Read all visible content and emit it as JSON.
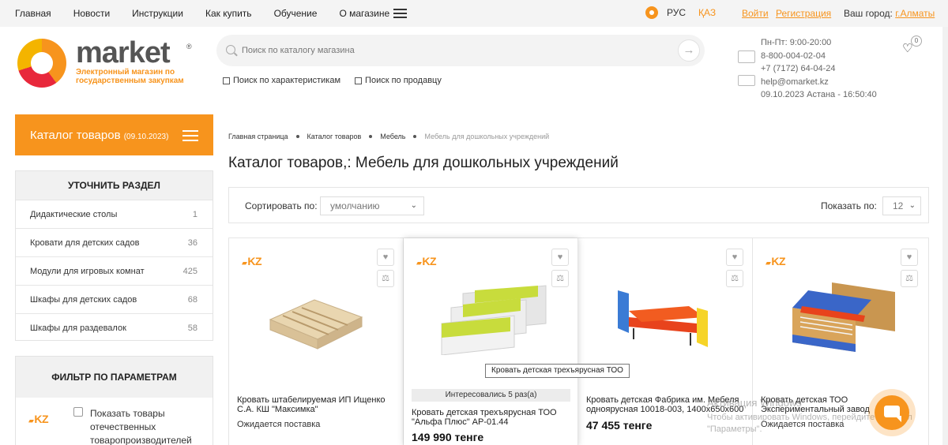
{
  "topnav": {
    "links": [
      "Главная",
      "Новости",
      "Инструкции",
      "Как купить",
      "Обучение",
      "О магазине"
    ],
    "lang_ru": "РУС",
    "lang_kz": "ҚАЗ",
    "login": "Войти",
    "register": "Регистрация",
    "city_label": "Ваш город:",
    "city": "г.Алматы"
  },
  "logo": {
    "word": "market",
    "reg": "®",
    "tagline": "Электронный магазин по государственным закупкам"
  },
  "search": {
    "placeholder": "Поиск по каталогу магазина",
    "go": "→",
    "opt1": "Поиск по характеристикам",
    "opt2": "Поиск по продавцу"
  },
  "contacts": {
    "hours": "Пн-Пт: 9:00-20:00",
    "phone1": "8-800-004-02-04",
    "phone2": "+7 (7172) 64-04-24",
    "email": "help@omarket.kz",
    "datetime": "09.10.2023   Астана - 16:50:40",
    "fav_count": "0"
  },
  "catalog": {
    "title": "Каталог товаров",
    "date": "(09.10.2023)"
  },
  "sections": {
    "title": "УТОЧНИТЬ РАЗДЕЛ",
    "items": [
      {
        "name": "Дидактические столы",
        "count": "1"
      },
      {
        "name": "Кровати для детских садов",
        "count": "36"
      },
      {
        "name": "Модули для игровых комнат",
        "count": "425"
      },
      {
        "name": "Шкафы для детских садов",
        "count": "68"
      },
      {
        "name": "Шкафы для раздевалок",
        "count": "58"
      }
    ]
  },
  "filter": {
    "title": "ФИЛЬТР ПО ПАРАМЕТРАМ",
    "kz_badge": "KZ",
    "domestic_label": "Показать товары отечественных товаропроизводителей"
  },
  "breadcrumb": [
    "Главная страница",
    "Каталог товаров",
    "Мебель",
    "Мебель для дошкольных учреждений"
  ],
  "page_title": "Каталог товаров,: Мебель для дошкольных учреждений",
  "sort": {
    "label": "Сортировать по:",
    "value": "умолчанию",
    "show_label": "Показать по:",
    "show_value": "12"
  },
  "products": [
    {
      "kz": "KZ",
      "name": "Кровать штабелируемая ИП Ищенко С.А. КШ \"Максимка\"",
      "status": "Ожидается поставка"
    },
    {
      "kz": "KZ",
      "interest": "Интересовались 5 раз(а)",
      "name": "Кровать детская трехъярусная ТОО \"Альфа Плюс\" АР-01.44",
      "price": "149 990 тенге",
      "tooltip": "Кровать детская трехъярусная ТОО"
    },
    {
      "name": "Кровать детская Фабрика им. Мебеля одноярусная 10018-003, 1400х650х600",
      "price": "47 455 тенге"
    },
    {
      "kz": "KZ",
      "name": "Кровать детская ТОО Экспериментальный завод",
      "status": "Ожидается поставка"
    }
  ],
  "activation": {
    "line1": "Активация Windows",
    "line2": "Чтобы активировать Windows, перейдите в раздел",
    "line3": "\"Параметры\"."
  },
  "colors": {
    "accent": "#f7941d",
    "brand_red": "#e8283b"
  }
}
